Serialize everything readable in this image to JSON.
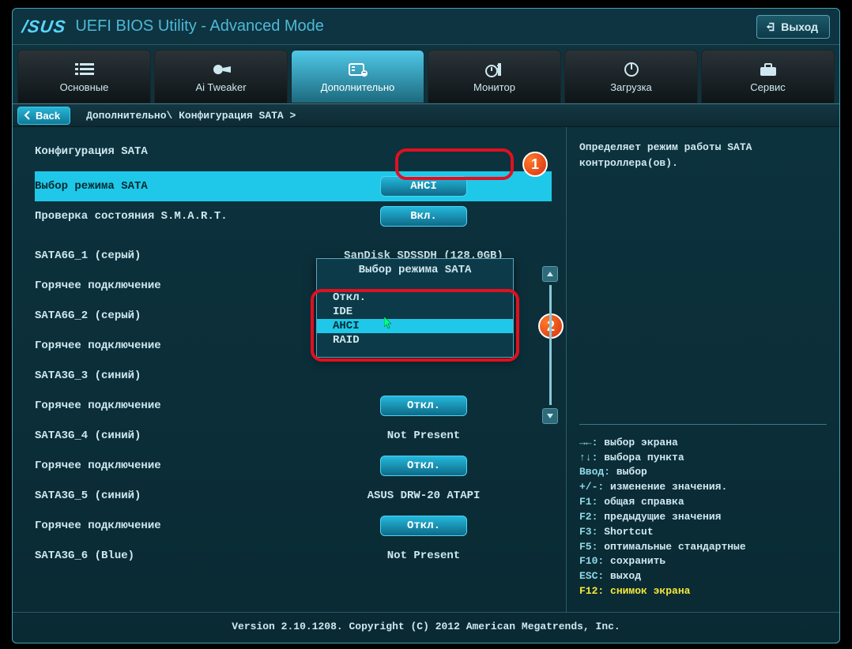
{
  "header": {
    "logo": "/SUS",
    "title": "UEFI BIOS Utility - Advanced Mode",
    "exit_label": "Выход"
  },
  "tabs": [
    {
      "id": "main",
      "label": "Основные"
    },
    {
      "id": "tweaker",
      "label": "Ai Tweaker"
    },
    {
      "id": "advanced",
      "label": "Дополнительно"
    },
    {
      "id": "monitor",
      "label": "Монитор"
    },
    {
      "id": "boot",
      "label": "Загрузка"
    },
    {
      "id": "service",
      "label": "Сервис"
    }
  ],
  "back_label": "Back",
  "breadcrumb": "Дополнительно\\ Конфигурация SATA >",
  "section_title": "Конфигурация SATA",
  "rows": [
    {
      "label": "Выбор режима SATA",
      "value": "AHCI",
      "type": "button",
      "selected": true
    },
    {
      "label": "Проверка состояния S.M.A.R.T.",
      "value": "Вкл.",
      "type": "button"
    },
    {
      "label": "SATA6G_1 (серый)",
      "value": "SanDisk SDSSDH (128.0GB)",
      "type": "text"
    },
    {
      "label": "Горячее подключение",
      "value": "",
      "type": "hidden"
    },
    {
      "label": "SATA6G_2 (серый)",
      "value": "",
      "type": "hidden"
    },
    {
      "label": "Горячее подключение",
      "value": "",
      "type": "hidden"
    },
    {
      "label": "SATA3G_3 (синий)",
      "value": "",
      "type": "hidden"
    },
    {
      "label": "Горячее подключение",
      "value": "Откл.",
      "type": "button"
    },
    {
      "label": "SATA3G_4 (синий)",
      "value": "Not Present",
      "type": "text"
    },
    {
      "label": "Горячее подключение",
      "value": "Откл.",
      "type": "button"
    },
    {
      "label": "SATA3G_5 (синий)",
      "value": "ASUS    DRW-20 ATAPI",
      "type": "text"
    },
    {
      "label": "Горячее подключение",
      "value": "Откл.",
      "type": "button"
    },
    {
      "label": "SATA3G_6 (Blue)",
      "value": "Not Present",
      "type": "text"
    }
  ],
  "dropdown": {
    "title": "Выбор режима SATA",
    "items": [
      "Откл.",
      "IDE",
      "AHCI",
      "RAID"
    ],
    "selected": "AHCI"
  },
  "help_text": "Определяет режим работы SATA контроллера(ов).",
  "keys": [
    {
      "k": "→←:",
      "d": "выбор экрана"
    },
    {
      "k": "↑↓:",
      "d": "выбора пункта"
    },
    {
      "k": "Ввод:",
      "d": "выбор"
    },
    {
      "k": "+/-:",
      "d": "изменение значения."
    },
    {
      "k": "F1:",
      "d": "общая справка"
    },
    {
      "k": "F2:",
      "d": "предыдущие значения"
    },
    {
      "k": "F3:",
      "d": "Shortcut"
    },
    {
      "k": "F5:",
      "d": "оптимальные стандартные"
    },
    {
      "k": "F10:",
      "d": "сохранить"
    },
    {
      "k": "ESC:",
      "d": "выход"
    },
    {
      "k": "F12:",
      "d": "снимок экрана",
      "yellow": true
    }
  ],
  "footer": "Version 2.10.1208. Copyright (C) 2012 American Megatrends, Inc.",
  "badges": {
    "one": "1",
    "two": "2"
  }
}
